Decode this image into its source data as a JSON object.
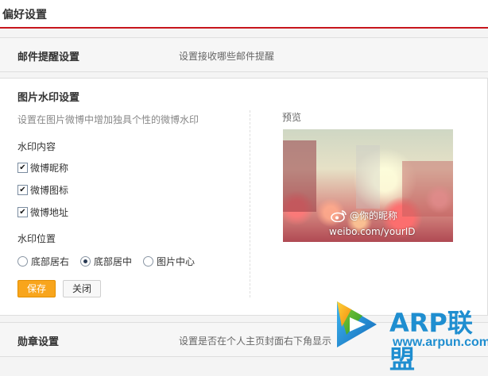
{
  "header": {
    "title": "偏好设置"
  },
  "mail_section": {
    "title": "邮件提醒设置",
    "desc": "设置接收哪些邮件提醒"
  },
  "watermark": {
    "title": "图片水印设置",
    "desc": "设置在图片微博中增加独具个性的微博水印",
    "content_label": "水印内容",
    "options": [
      {
        "label": "微博昵称",
        "checked": true
      },
      {
        "label": "微博图标",
        "checked": true
      },
      {
        "label": "微博地址",
        "checked": true
      }
    ],
    "position_label": "水印位置",
    "positions": [
      {
        "label": "底部居右",
        "selected": false
      },
      {
        "label": "底部居中",
        "selected": true
      },
      {
        "label": "图片中心",
        "selected": false
      }
    ],
    "save_label": "保存",
    "close_label": "关闭",
    "preview_label": "预览",
    "preview_nickname": "@你的昵称",
    "preview_url": "weibo.com/yourID"
  },
  "medal_section": {
    "title": "勋章设置",
    "desc": "设置是否在个人主页封面右下角显示"
  },
  "logo": {
    "brand": "ARP联盟",
    "url": "www.arpun.com"
  },
  "colors": {
    "accent_red": "#c8161d",
    "save_orange": "#f8a51c",
    "logo_blue": "#1f8ed0"
  }
}
